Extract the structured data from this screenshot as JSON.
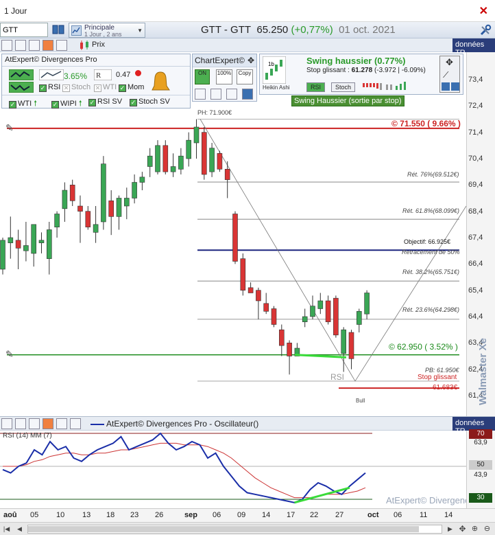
{
  "window": {
    "title": "1 Jour"
  },
  "toolbar": {
    "ticker_value": "GTT",
    "layout_name": "Principale",
    "layout_sub": "1 Jour , 2 ans",
    "header_symbol": "GTT - GTT",
    "header_price": "65.250",
    "header_change": "(+0,77%)",
    "header_date": "01 oct. 2021",
    "prix_label": "Prix",
    "data_label": "données TR"
  },
  "adiv_panel": {
    "title": "AtExpert© Divergences Pro",
    "pct": "3.65%",
    "r_value": "0.47",
    "checks": {
      "rsi": "RSI",
      "stoch": "Stoch",
      "wti": "WTI",
      "mom": "Mom",
      "wti2": "WTI",
      "wipi": "WIPI",
      "rsisv": "RSI SV",
      "stochsv": "Stoch SV"
    }
  },
  "chartexpert": {
    "title": "ChartExpert©",
    "on": "ON",
    "pct100": "100%",
    "copy": "Copy"
  },
  "swing_panel": {
    "heikin_label": "Heikin Ashi",
    "title": "Swing haussier (0.77%)",
    "stop_prefix": "Stop glissant : ",
    "stop_value": "61.278",
    "stop_suffix": " (-3.972 | -6.09%)",
    "rsi_btn": "RSI",
    "stoch_btn": "Stoch",
    "banner": "Swing Haussier (sortie par stop)"
  },
  "chart_annotations": {
    "ph": "PH: 71.900€",
    "resistance": "© 71.550 ( 9.66% )",
    "ret76": "Rét. 76%(69.512€)",
    "ret618": "Rét. 61.8%(68.099€)",
    "objectif": "Objectif: 66.925€",
    "retrace50": "Retracement de 50%",
    "ret382": "Rét. 38.2%(65.751€)",
    "ret236": "Rét. 23.6%(64.298€)",
    "support": "© 62.950 ( 3.52% )",
    "rsi_mark": "RSI",
    "pb": "PB: 61.950€",
    "stop_label": "Stop glissant",
    "stop_val": "61.683€",
    "bull": "Bull"
  },
  "watermark": "Walmaster Xe",
  "y_axis": [
    "73,4",
    "72,4",
    "71,4",
    "70,4",
    "69,4",
    "68,4",
    "67,4",
    "66,4",
    "65,4",
    "64,4",
    "63,4",
    "62,4",
    "61,4"
  ],
  "oscillator": {
    "legend": "AtExpert© Divergences Pro - Oscillateur()",
    "data_label": "données TR",
    "rsi_label": "RSI (14) MM (7)",
    "axis": [
      "70",
      "63,9",
      "50",
      "43,9",
      "30"
    ],
    "watermark": "AtExpert© Divergences Pro"
  },
  "x_axis": [
    "aoû",
    "05",
    "10",
    "13",
    "18",
    "23",
    "26",
    "sep",
    "06",
    "09",
    "14",
    "17",
    "22",
    "27",
    "oct",
    "06",
    "11",
    "14"
  ],
  "colors": {
    "up": "#3aa655",
    "down": "#d93535",
    "resistance": "#cc2222",
    "support": "#1a8a1a",
    "objective": "#1a237e",
    "rsi": "#1a2ea8",
    "ma": "#cc3333"
  },
  "chart_data": {
    "type": "candlestick",
    "ylim": [
      60.9,
      74.0
    ],
    "candles": [
      {
        "o": 66.2,
        "h": 67.4,
        "l": 66.0,
        "c": 67.3
      },
      {
        "o": 67.2,
        "h": 68.2,
        "l": 66.6,
        "c": 67.4
      },
      {
        "o": 67.3,
        "h": 67.7,
        "l": 66.2,
        "c": 67.0
      },
      {
        "o": 66.9,
        "h": 68.0,
        "l": 66.5,
        "c": 67.1
      },
      {
        "o": 66.8,
        "h": 67.6,
        "l": 66.3,
        "c": 67.9
      },
      {
        "o": 67.2,
        "h": 67.6,
        "l": 66.8,
        "c": 67.3
      },
      {
        "o": 66.6,
        "h": 68.0,
        "l": 66.0,
        "c": 67.7
      },
      {
        "o": 67.8,
        "h": 68.4,
        "l": 67.4,
        "c": 68.3
      },
      {
        "o": 68.5,
        "h": 69.5,
        "l": 68.0,
        "c": 69.2
      },
      {
        "o": 69.4,
        "h": 69.6,
        "l": 68.6,
        "c": 68.8
      },
      {
        "o": 68.6,
        "h": 69.0,
        "l": 67.2,
        "c": 68.4
      },
      {
        "o": 68.4,
        "h": 68.6,
        "l": 67.7,
        "c": 67.8
      },
      {
        "o": 67.6,
        "h": 68.6,
        "l": 67.2,
        "c": 67.9
      },
      {
        "o": 68.0,
        "h": 70.5,
        "l": 67.7,
        "c": 70.2
      },
      {
        "o": 68.8,
        "h": 69.2,
        "l": 67.5,
        "c": 68.2
      },
      {
        "o": 68.2,
        "h": 69.0,
        "l": 67.7,
        "c": 68.9
      },
      {
        "o": 68.6,
        "h": 69.3,
        "l": 68.1,
        "c": 68.9
      },
      {
        "o": 68.9,
        "h": 69.8,
        "l": 68.7,
        "c": 69.5
      },
      {
        "o": 69.5,
        "h": 69.9,
        "l": 69.2,
        "c": 69.7
      },
      {
        "o": 70.1,
        "h": 70.8,
        "l": 69.7,
        "c": 70.5
      },
      {
        "o": 69.9,
        "h": 71.1,
        "l": 69.8,
        "c": 70.9
      },
      {
        "o": 70.9,
        "h": 71.1,
        "l": 69.8,
        "c": 69.9
      },
      {
        "o": 69.9,
        "h": 70.6,
        "l": 69.7,
        "c": 70.1
      },
      {
        "o": 70.0,
        "h": 70.8,
        "l": 69.8,
        "c": 70.5
      },
      {
        "o": 70.4,
        "h": 71.4,
        "l": 70.1,
        "c": 71.1
      },
      {
        "o": 71.0,
        "h": 71.9,
        "l": 70.4,
        "c": 71.6
      },
      {
        "o": 71.4,
        "h": 71.6,
        "l": 69.6,
        "c": 69.8
      },
      {
        "o": 69.9,
        "h": 71.0,
        "l": 69.7,
        "c": 70.8
      },
      {
        "o": 70.6,
        "h": 70.7,
        "l": 69.9,
        "c": 70.0
      },
      {
        "o": 70.0,
        "h": 70.3,
        "l": 68.9,
        "c": 69.6
      },
      {
        "o": 68.3,
        "h": 68.4,
        "l": 66.4,
        "c": 66.5
      },
      {
        "o": 66.6,
        "h": 66.8,
        "l": 65.2,
        "c": 65.4
      },
      {
        "o": 65.5,
        "h": 65.7,
        "l": 65.3,
        "c": 65.3
      },
      {
        "o": 65.4,
        "h": 65.5,
        "l": 64.3,
        "c": 65.0
      },
      {
        "o": 64.9,
        "h": 65.3,
        "l": 64.5,
        "c": 64.6
      },
      {
        "o": 64.7,
        "h": 64.8,
        "l": 64.0,
        "c": 64.1
      },
      {
        "o": 63.9,
        "h": 64.1,
        "l": 62.9,
        "c": 63.3
      },
      {
        "o": 63.4,
        "h": 63.5,
        "l": 62.2,
        "c": 62.9
      },
      {
        "o": 62.9,
        "h": 63.4,
        "l": 62.9,
        "c": 63.2
      },
      {
        "o": 64.2,
        "h": 64.7,
        "l": 64.0,
        "c": 64.4
      },
      {
        "o": 64.4,
        "h": 65.2,
        "l": 64.3,
        "c": 64.8
      },
      {
        "o": 64.7,
        "h": 65.3,
        "l": 64.5,
        "c": 65.0
      },
      {
        "o": 65.0,
        "h": 65.2,
        "l": 64.1,
        "c": 64.2
      },
      {
        "o": 65.1,
        "h": 65.2,
        "l": 63.6,
        "c": 63.7
      },
      {
        "o": 63.0,
        "h": 64.0,
        "l": 62.3,
        "c": 63.9
      },
      {
        "o": 63.8,
        "h": 63.9,
        "l": 62.4,
        "c": 62.8
      },
      {
        "o": 64.1,
        "h": 64.7,
        "l": 63.8,
        "c": 64.6
      },
      {
        "o": 64.5,
        "h": 65.4,
        "l": 64.3,
        "c": 65.3
      }
    ]
  }
}
